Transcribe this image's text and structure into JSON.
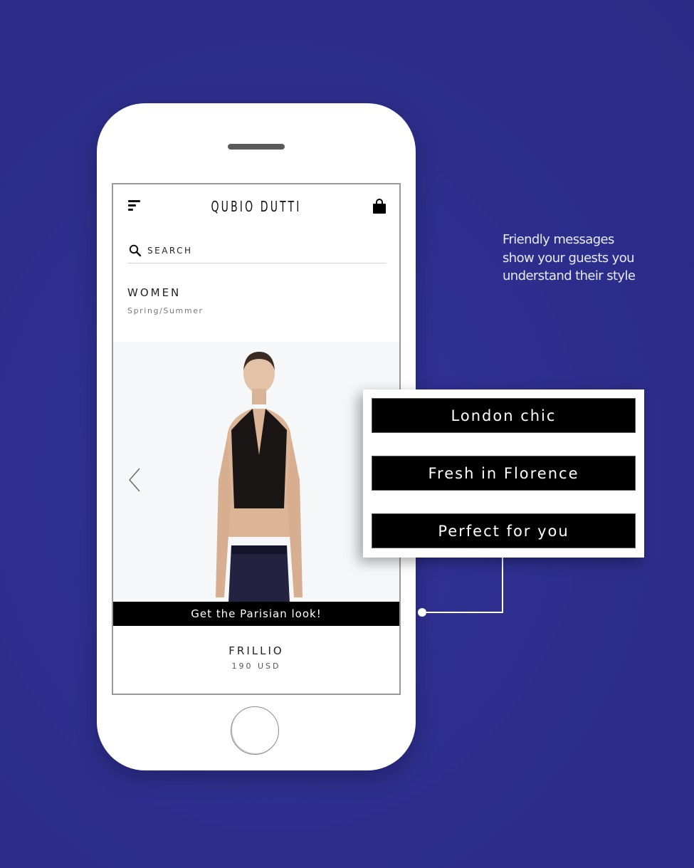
{
  "colors": {
    "background": "#2e2f8f",
    "phone_body": "#ffffff",
    "promo_bar": "#000000",
    "annotation_text": "#e9eaf7"
  },
  "app": {
    "brand": "QUBIO DUTTI",
    "menu_icon": "menu-icon",
    "bag_icon": "shopping-bag-icon"
  },
  "search": {
    "icon": "search-icon",
    "placeholder": "SEARCH",
    "value": ""
  },
  "category": {
    "title": "WOMEN",
    "subtitle": "Spring/Summer"
  },
  "product": {
    "carousel_prev_icon": "chevron-left-icon",
    "promo_message": "Get the Parisian look!",
    "name": "FRILLIO",
    "price": "190 USD"
  },
  "annotation": {
    "text": "Friendly messages show your guests you understand their style"
  },
  "message_options": [
    {
      "label": "London chic"
    },
    {
      "label": "Fresh in Florence"
    },
    {
      "label": "Perfect for you"
    }
  ]
}
